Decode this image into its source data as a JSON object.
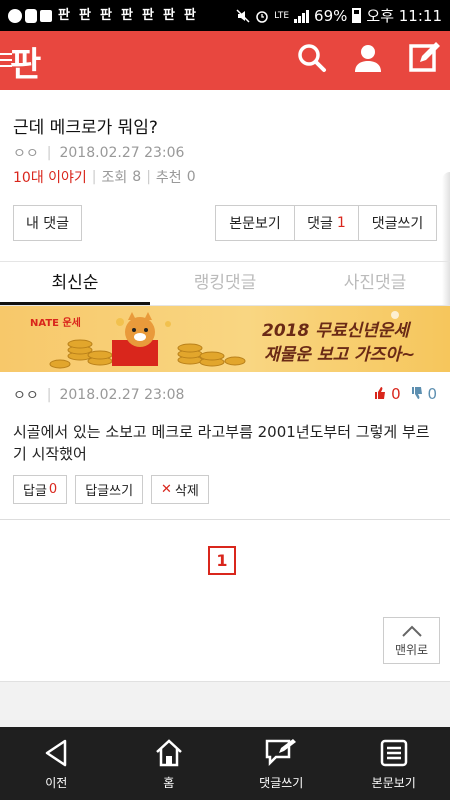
{
  "status_bar": {
    "left_icons": [
      "message-icon",
      "link-icon",
      "image-icon"
    ],
    "pan_glyphs": [
      "판",
      "판",
      "판",
      "판",
      "판",
      "판",
      "판"
    ],
    "network": "LTE",
    "battery": "69%",
    "clock": "오후 11:11"
  },
  "app_bar": {
    "logo": "판",
    "actions": [
      "search-icon",
      "user-icon",
      "write-icon"
    ],
    "brand_color": "#e8473f"
  },
  "post": {
    "title": "근데 메크로가 뭐임?",
    "author": "ㅇㅇ",
    "date": "2018.02.27 23:06",
    "category": "10대 이야기",
    "views_label": "조회",
    "views": "8",
    "recommend_label": "추천",
    "recommend": "0"
  },
  "buttons": {
    "my_comments": "내 댓글",
    "view_post": "본문보기",
    "comments": "댓글",
    "comments_count": "1",
    "write_comment": "댓글쓰기"
  },
  "tabs": [
    {
      "label": "최신순",
      "active": true
    },
    {
      "label": "랭킹댓글",
      "active": false
    },
    {
      "label": "사진댓글",
      "active": false
    }
  ],
  "banner": {
    "brand": "NATE 운세",
    "line1": "2018 무료신년운세",
    "line2": "재물운 보고 가즈아~"
  },
  "comment": {
    "author": "ㅇㅇ",
    "date": "2018.02.27 23:08",
    "upvotes": "0",
    "downvotes": "0",
    "text": "시골에서 있는 소보고 메크로 라고부름 2001년도부터 그렇게 부르기 시작했어",
    "reply_label": "답글",
    "reply_count": "0",
    "write_reply": "답글쓰기",
    "delete": "삭제"
  },
  "pagination": {
    "current": "1"
  },
  "to_top": "맨위로",
  "bottom_nav": [
    {
      "label": "이전",
      "icon": "back-icon"
    },
    {
      "label": "홈",
      "icon": "home-icon"
    },
    {
      "label": "댓글쓰기",
      "icon": "write-comment-icon"
    },
    {
      "label": "본문보기",
      "icon": "document-icon"
    }
  ]
}
